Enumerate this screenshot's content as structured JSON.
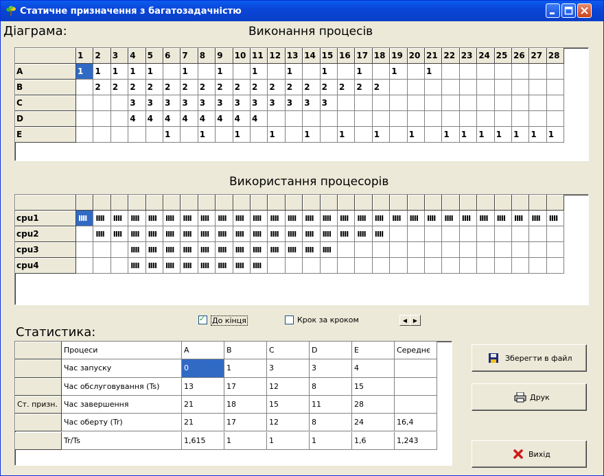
{
  "window": {
    "title": "Статичне призначення з багатозадачністю"
  },
  "diagram": {
    "label": "Діаграма:",
    "title": "Виконання процесів",
    "columns": [
      "1",
      "2",
      "3",
      "4",
      "5",
      "6",
      "7",
      "8",
      "9",
      "10",
      "11",
      "12",
      "13",
      "14",
      "15",
      "16",
      "17",
      "18",
      "19",
      "20",
      "21",
      "22",
      "23",
      "24",
      "25",
      "26",
      "27",
      "28"
    ],
    "rows": [
      {
        "name": "A",
        "cells": [
          "1",
          "1",
          "1",
          "1",
          "1",
          "",
          "1",
          "",
          "1",
          "",
          "1",
          "",
          "1",
          "",
          "1",
          "",
          "1",
          "",
          "1",
          "",
          "1",
          "",
          "",
          "",
          "",
          "",
          "",
          ""
        ]
      },
      {
        "name": "B",
        "cells": [
          "",
          "2",
          "2",
          "2",
          "2",
          "2",
          "2",
          "2",
          "2",
          "2",
          "2",
          "2",
          "2",
          "2",
          "2",
          "2",
          "2",
          "2",
          "",
          "",
          "",
          "",
          "",
          "",
          "",
          "",
          "",
          ""
        ]
      },
      {
        "name": "C",
        "cells": [
          "",
          "",
          "",
          "3",
          "3",
          "3",
          "3",
          "3",
          "3",
          "3",
          "3",
          "3",
          "3",
          "3",
          "3",
          "",
          "",
          "",
          "",
          "",
          "",
          "",
          "",
          "",
          "",
          "",
          "",
          ""
        ]
      },
      {
        "name": "D",
        "cells": [
          "",
          "",
          "",
          "4",
          "4",
          "4",
          "4",
          "4",
          "4",
          "4",
          "4",
          "",
          "",
          "",
          "",
          "",
          "",
          "",
          "",
          "",
          "",
          "",
          "",
          "",
          "",
          "",
          "",
          ""
        ]
      },
      {
        "name": "E",
        "cells": [
          "",
          "",
          "",
          "",
          "",
          "1",
          "",
          "1",
          "",
          "1",
          "",
          "1",
          "",
          "1",
          "",
          "1",
          "",
          "1",
          "",
          "1",
          "",
          "1",
          "1",
          "1",
          "1",
          "1",
          "1",
          "1"
        ]
      }
    ]
  },
  "cpu": {
    "title": "Використання процесорів",
    "bar_glyph": "IIII",
    "rows": [
      {
        "name": "cpu1",
        "from": 1,
        "to": 28
      },
      {
        "name": "cpu2",
        "from": 2,
        "to": 18
      },
      {
        "name": "cpu3",
        "from": 4,
        "to": 15
      },
      {
        "name": "cpu4",
        "from": 4,
        "to": 11
      }
    ]
  },
  "controls": {
    "to_end_label": "До кінця",
    "to_end_checked": true,
    "step_label": "Крок за кроком",
    "step_checked": false
  },
  "stats": {
    "label": "Статистика:",
    "row_group": "Ст. призн.",
    "header": [
      "Процеси",
      "A",
      "B",
      "C",
      "D",
      "E",
      "Середнє"
    ],
    "rows": [
      [
        "Час запуску",
        "0",
        "1",
        "3",
        "3",
        "4",
        ""
      ],
      [
        "Час обслуговування (Ts)",
        "13",
        "17",
        "12",
        "8",
        "15",
        ""
      ],
      [
        "Час завершення",
        "21",
        "18",
        "15",
        "11",
        "28",
        ""
      ],
      [
        "Час оберту (Tr)",
        "21",
        "17",
        "12",
        "8",
        "24",
        "16,4"
      ],
      [
        "Tr/Ts",
        "1,615",
        "1",
        "1",
        "1",
        "1,6",
        "1,243"
      ]
    ]
  },
  "buttons": {
    "save": "Зберегти в файл",
    "print": "Друк",
    "exit": "Вихід"
  }
}
